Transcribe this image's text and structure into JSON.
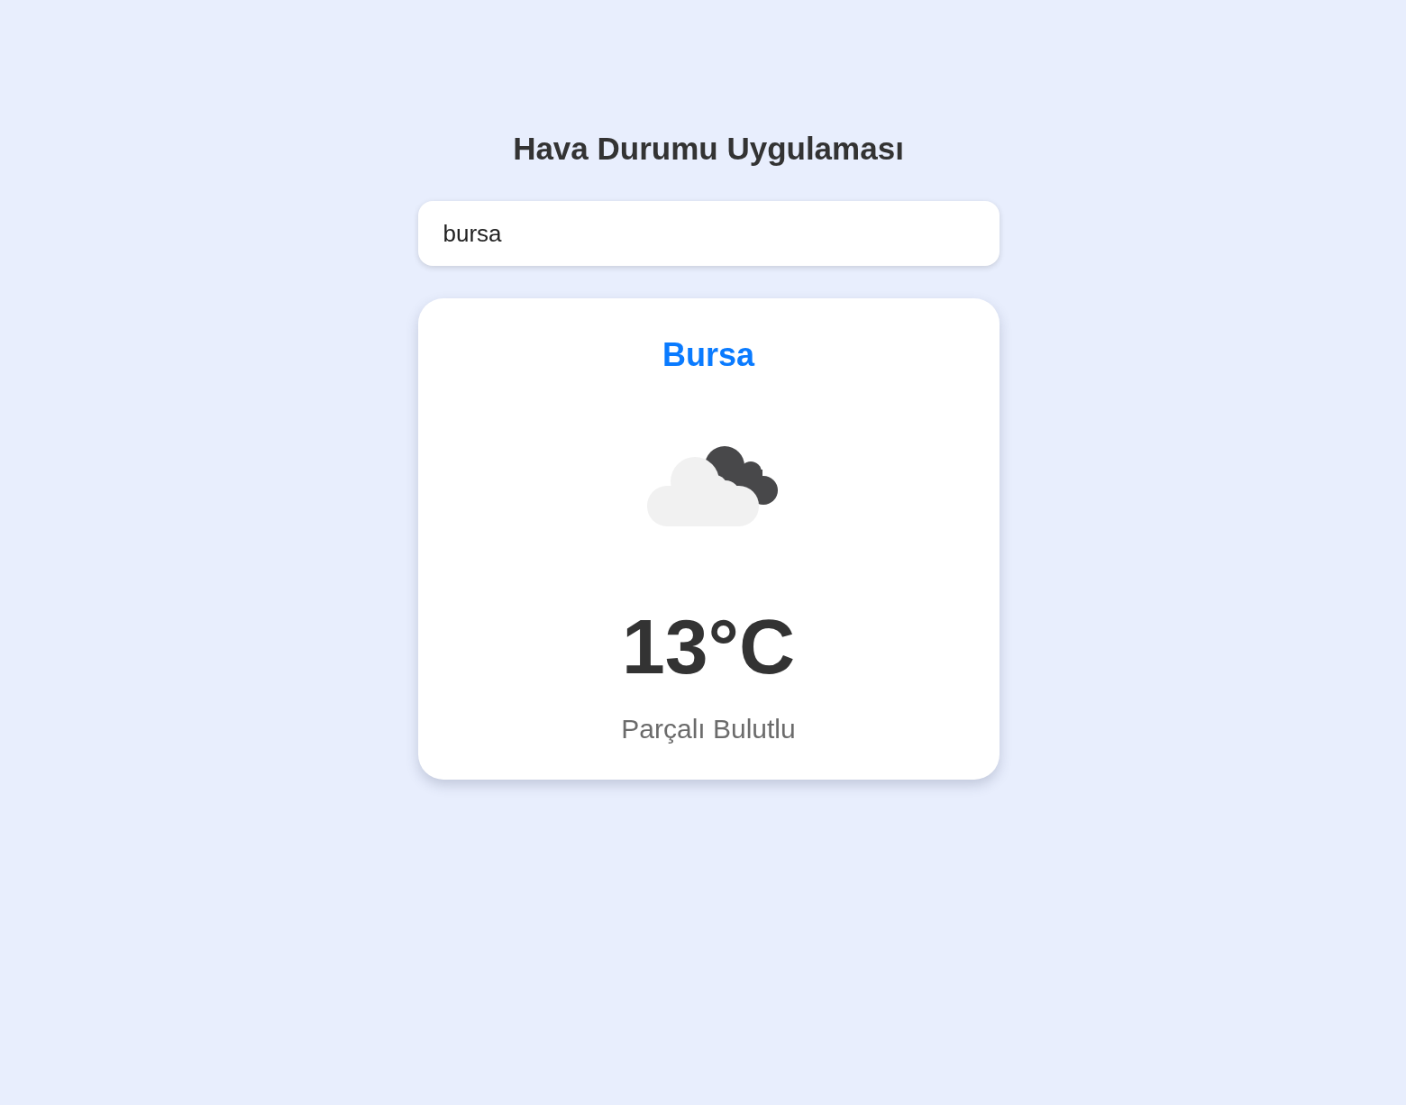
{
  "title": "Hava Durumu Uygulaması",
  "search": {
    "value": "bursa"
  },
  "weather": {
    "city": "Bursa",
    "temperature": "13°C",
    "description": "Parçalı Bulutlu"
  }
}
